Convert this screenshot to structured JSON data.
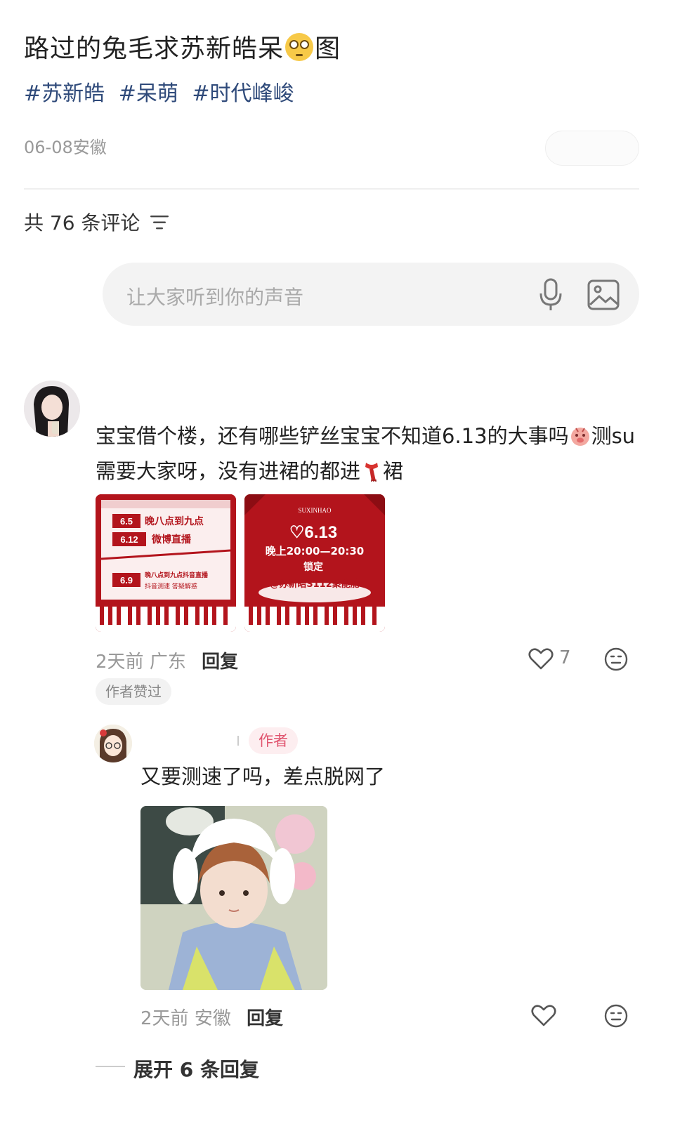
{
  "post": {
    "title_before": "路过的兔毛求苏新皓呆",
    "title_emoji": "flushed-face-emoji",
    "title_after": "图",
    "tags": [
      "#苏新皓",
      "#呆萌",
      "#时代峰峻"
    ],
    "meta": "06-08安徽"
  },
  "comments_header": {
    "count_label": "共 76 条评论",
    "sort_icon": "sort-icon"
  },
  "input": {
    "placeholder": "让大家听到你的声音",
    "mic_icon": "microphone-icon",
    "image_icon": "image-icon"
  },
  "comment1": {
    "text_part1": "宝宝借个楼，还有哪些铲丝宝宝不知道6.13的大事吗",
    "text_part2": "测su需要大家呀，没有进裙的都进",
    "text_part3": "裙",
    "time": "2天前",
    "location": "广东",
    "reply_label": "回复",
    "likes": "7",
    "liked_by_author": "作者赞过",
    "poster1": {
      "rows": [
        {
          "date": "6.5",
          "text": "晚八点到九点"
        },
        {
          "date": "6.12",
          "text": "微博直播"
        },
        {
          "date": "6.9",
          "text": "晚八点到九点抖音直播"
        }
      ],
      "subtext": "抖音测速  答疑解惑"
    },
    "poster2": {
      "brand": "SUXINHAO",
      "date": "♡6.13",
      "time": "晚上20:00—20:30",
      "lock": "锁定",
      "handle": "@苏新皓S112聚能舱"
    }
  },
  "reply1": {
    "author_badge": "作者",
    "text": "又要测速了吗，差点脱网了",
    "time": "2天前",
    "location": "安徽",
    "reply_label": "回复"
  },
  "expand_label": "展开 6 条回复",
  "colors": {
    "tag": "#2f4a7a",
    "poster_red": "#b3141c",
    "author_badge": "#e0546e"
  }
}
